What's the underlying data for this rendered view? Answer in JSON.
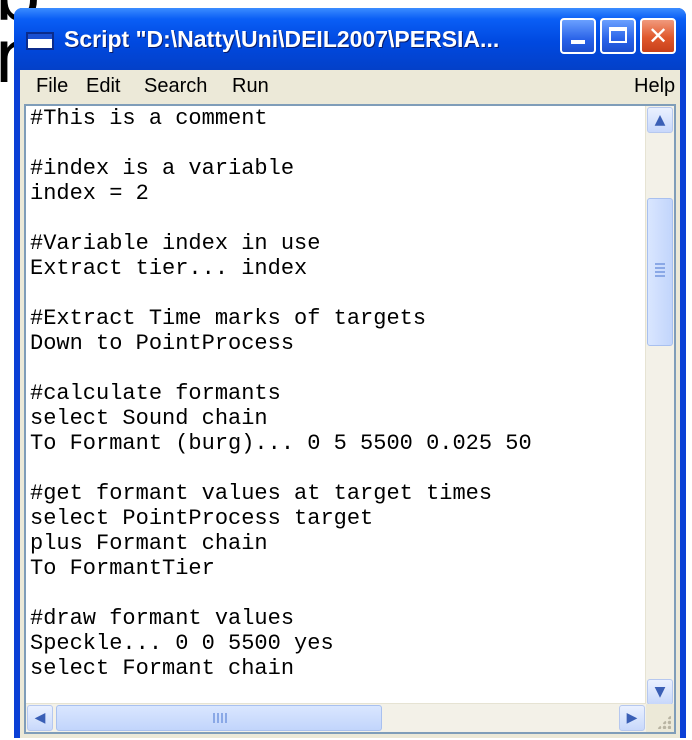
{
  "background": {
    "partial_text": "b\nn"
  },
  "window": {
    "title": "Script \"D:\\Natty\\Uni\\DEIL2007\\PERSIA...",
    "controls": {
      "minimize_icon": "minimize-icon",
      "maximize_icon": "maximize-icon",
      "close_icon": "close-icon",
      "close_glyph": "✕"
    }
  },
  "menu": {
    "file": "File",
    "edit": "Edit",
    "search": "Search",
    "run": "Run",
    "help": "Help"
  },
  "editor": {
    "lines": [
      "#This is a comment",
      "",
      "#index is a variable",
      "index = 2",
      "",
      "#Variable index in use",
      "Extract tier... index",
      "",
      "#Extract Time marks of targets",
      "Down to PointProcess",
      "",
      "#calculate formants",
      "select Sound chain",
      "To Formant (burg)... 0 5 5500 0.025 50",
      "",
      "#get formant values at target times",
      "select PointProcess target",
      "plus Formant chain",
      "To FormantTier",
      "",
      "#draw formant values",
      "Speckle... 0 0 5500 yes",
      "select Formant chain"
    ]
  },
  "scrollbars": {
    "up": "▲",
    "down": "▼",
    "left": "◀",
    "right": "▶"
  },
  "colors": {
    "titlebar": "#0049e0",
    "client": "#ece9d8",
    "editor_border": "#7f9db9",
    "close_button": "#e0582c"
  }
}
